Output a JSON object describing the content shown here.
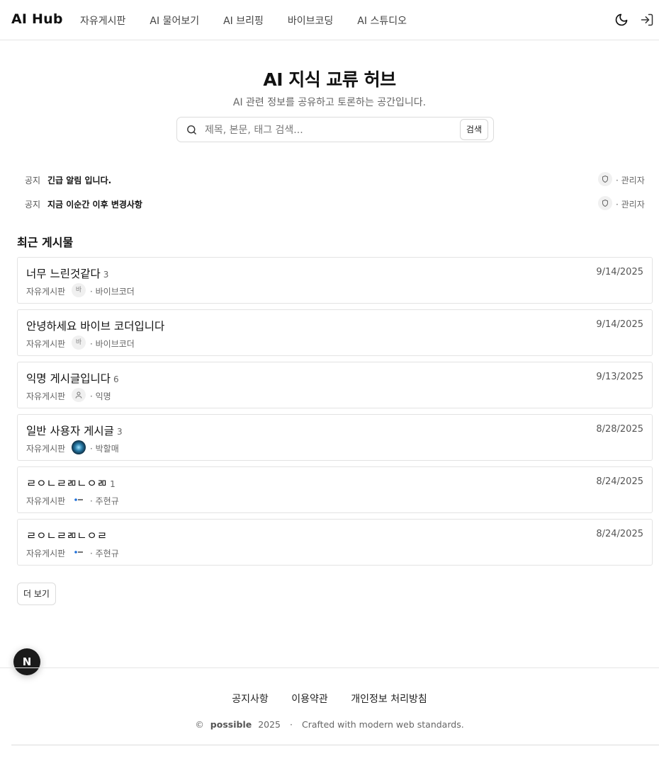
{
  "header": {
    "brand": "AI Hub",
    "nav": [
      "자유게시판",
      "AI 물어보기",
      "AI 브리핑",
      "바이브코딩",
      "AI 스튜디오"
    ],
    "icons": [
      "moon-icon",
      "login-icon"
    ]
  },
  "hero": {
    "title": "AI 지식 교류 허브",
    "subtitle": "AI 관련 정보를 공유하고 토론하는 공간입니다.",
    "search_placeholder": "제목, 본문, 태그 검색...",
    "search_button": "검색"
  },
  "notices": [
    {
      "tag": "공지",
      "title": "긴급 알림 입니다.",
      "author": "· 관리자"
    },
    {
      "tag": "공지",
      "title": "지금 이순간 이후 변경사항",
      "author": "· 관리자"
    }
  ],
  "recent_title": "최근 게시물",
  "posts": [
    {
      "title": "너무 느린것같다",
      "count": "3",
      "date": "9/14/2025",
      "board": "자유게시판",
      "avatar_text": "바",
      "author": "· 바이브코더"
    },
    {
      "title": "안녕하세요 바이브 코더입니다",
      "count": "",
      "date": "9/14/2025",
      "board": "자유게시판",
      "avatar_text": "바",
      "author": "· 바이브코더"
    },
    {
      "title": "익명 게시글입니다",
      "count": "6",
      "date": "9/13/2025",
      "board": "자유게시판",
      "avatar_text": "",
      "author": "· 익명"
    },
    {
      "title": "일반 사용자 게시글",
      "count": "3",
      "date": "8/28/2025",
      "board": "자유게시판",
      "avatar_text": "",
      "author": "· 박할매"
    },
    {
      "title": "ㄹㅇㄴㄹㄻㄴㅇㄻ",
      "count": "1",
      "date": "8/24/2025",
      "board": "자유게시판",
      "avatar_text": "",
      "author": "· 주현규"
    },
    {
      "title": "ㄹㅇㄴㄹㄻㄴㅇㄹ",
      "count": "",
      "date": "8/24/2025",
      "board": "자유게시판",
      "avatar_text": "",
      "author": "· 주현규"
    }
  ],
  "more_button": "더 보기",
  "floating_badge": "N",
  "footer": {
    "links": [
      "공지사항",
      "이용약관",
      "개인정보 처리방침"
    ],
    "copyright_symbol": "©",
    "company": "possible",
    "year": "2025",
    "separator": "·",
    "tagline": "Crafted with modern web standards."
  }
}
